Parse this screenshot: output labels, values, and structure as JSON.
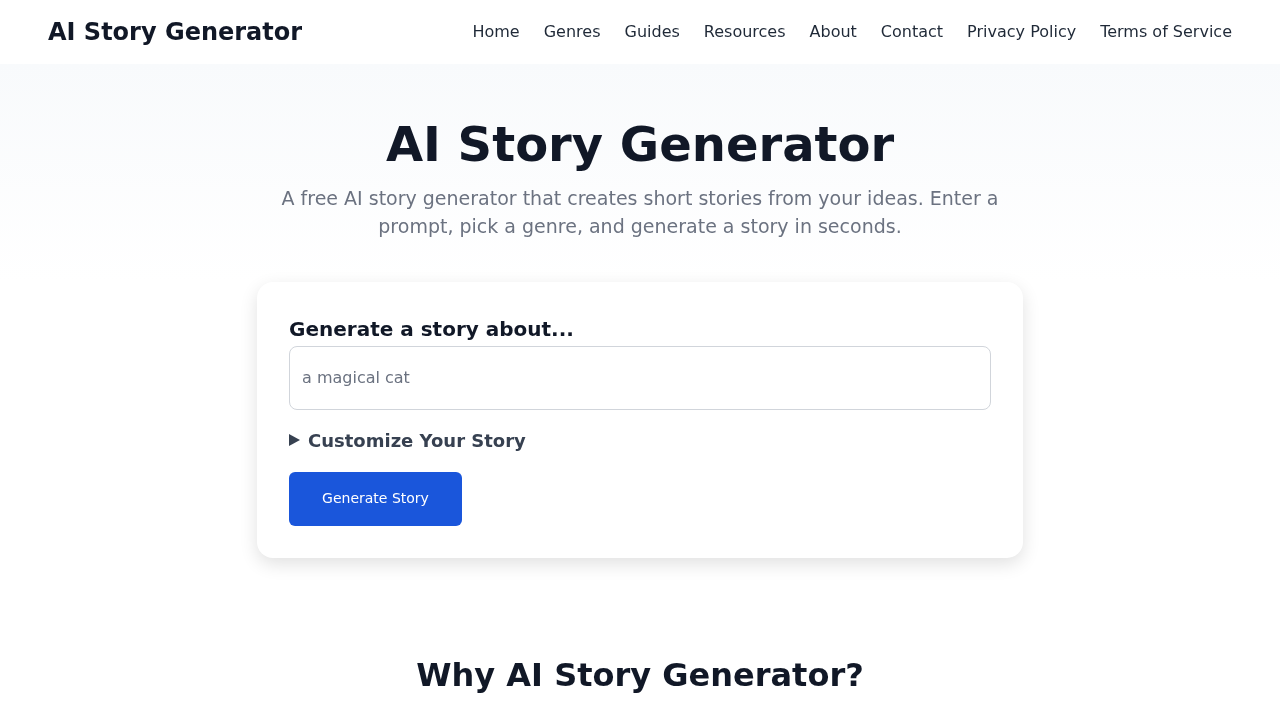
{
  "navbar": {
    "brand": "AI Story Generator",
    "links": [
      {
        "label": "Home"
      },
      {
        "label": "Genres"
      },
      {
        "label": "Guides"
      },
      {
        "label": "Resources"
      },
      {
        "label": "About"
      },
      {
        "label": "Contact"
      },
      {
        "label": "Privacy Policy"
      },
      {
        "label": "Terms of Service"
      }
    ]
  },
  "hero": {
    "title": "AI Story Generator",
    "subtitle": "A free AI story generator that creates short stories from your ideas. Enter a prompt, pick a genre, and generate a story in seconds."
  },
  "form": {
    "label": "Generate a story about...",
    "input": {
      "placeholder": "a magical cat"
    },
    "customize": {
      "label": "Customize Your Story",
      "expanded": false
    },
    "button": "Generate Story"
  },
  "section": {
    "title": "Why AI Story Generator?"
  }
}
